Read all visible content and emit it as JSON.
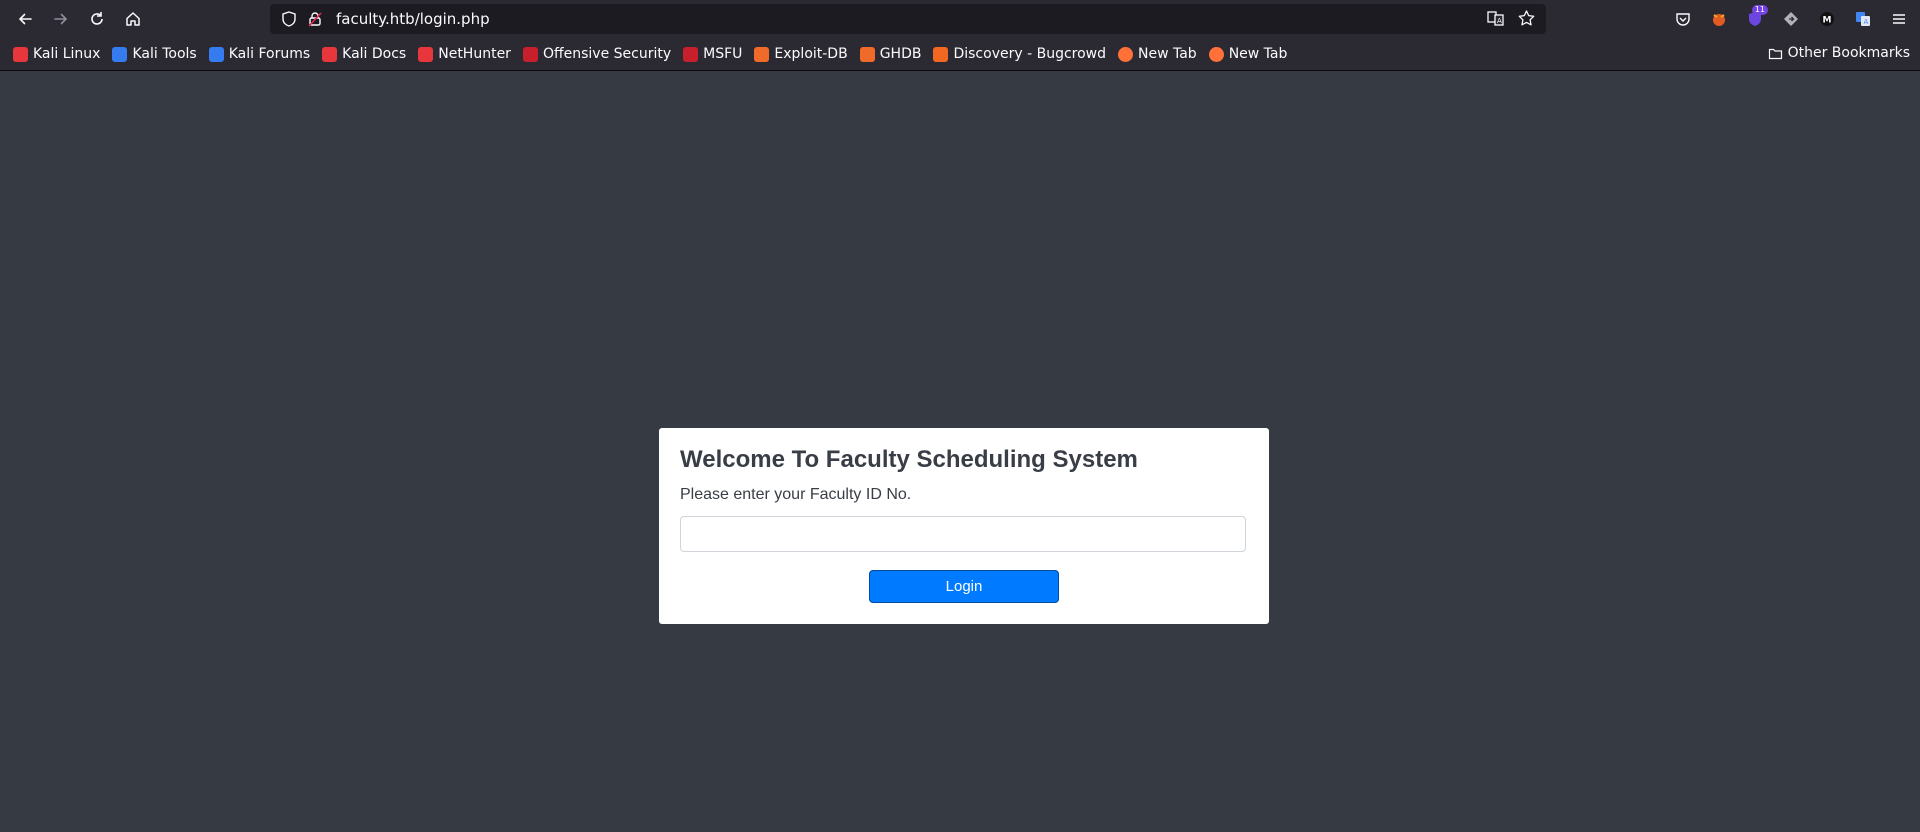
{
  "browser": {
    "url": "faculty.htb/login.php",
    "extension_badge": "11",
    "bookmarks": [
      {
        "label": "Kali Linux",
        "icon": "kali-icon",
        "color": "#e8363d"
      },
      {
        "label": "Kali Tools",
        "icon": "kali-tools-icon",
        "color": "#367bf0"
      },
      {
        "label": "Kali Forums",
        "icon": "kali-forums-icon",
        "color": "#367bf0"
      },
      {
        "label": "Kali Docs",
        "icon": "kali-docs-icon",
        "color": "#e8363d"
      },
      {
        "label": "NetHunter",
        "icon": "nethunter-icon",
        "color": "#e8363d"
      },
      {
        "label": "Offensive Security",
        "icon": "offsec-icon",
        "color": "#c81f2d"
      },
      {
        "label": "MSFU",
        "icon": "msfu-icon",
        "color": "#c81f2d"
      },
      {
        "label": "Exploit-DB",
        "icon": "exploitdb-icon",
        "color": "#f06a2a"
      },
      {
        "label": "GHDB",
        "icon": "ghdb-icon",
        "color": "#f06a2a"
      },
      {
        "label": "Discovery - Bugcrowd",
        "icon": "bugcrowd-icon",
        "color": "#f26822"
      },
      {
        "label": "New Tab",
        "icon": "firefox-icon",
        "color": "#ff7139"
      },
      {
        "label": "New Tab",
        "icon": "firefox-icon",
        "color": "#ff7139"
      }
    ],
    "other_bookmarks": "Other Bookmarks"
  },
  "login": {
    "title": "Welcome To Faculty Scheduling System",
    "label": "Please enter your Faculty ID No.",
    "input_value": "",
    "button_label": "Login"
  }
}
